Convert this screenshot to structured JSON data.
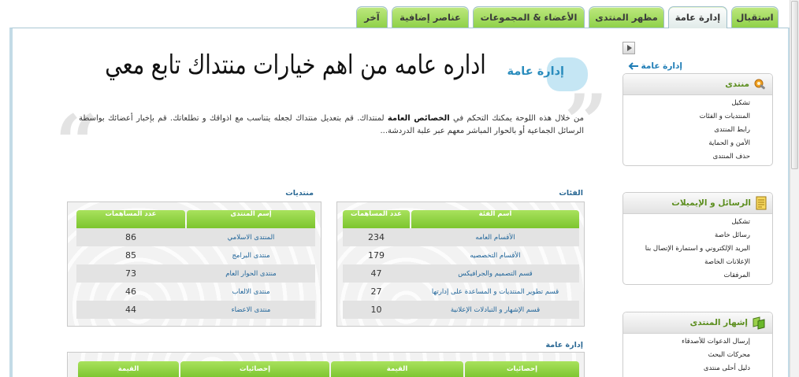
{
  "active_tab_index": 1,
  "colors": {
    "tab_green": "#8fd14a",
    "header_green": "#7cc52f",
    "link_blue": "#1f7db6",
    "section_title_green": "#5c8e1f",
    "title_bubble": "#c5e6f4"
  },
  "tabs": [
    {
      "label": "استقبال"
    },
    {
      "label": "إدارة عامة"
    },
    {
      "label": "مظهر المنتدى"
    },
    {
      "label": "الأعضاء & المجموعات"
    },
    {
      "label": "عناصر إضافية"
    },
    {
      "label": "آخر"
    }
  ],
  "sidebar": {
    "collapse_icon": "play-arrow-icon",
    "link": {
      "label": "إدارة عامة",
      "icon": "arrow-left-icon"
    },
    "sections": [
      {
        "title": "منتدى",
        "icon": "wrench-icon",
        "items": [
          "تشكيل",
          "المنتديات و الفئات",
          "رابط المنتدى",
          "الأمن و الحماية",
          "حذف المنتدى"
        ]
      },
      {
        "title": "الرسائل و الإيميلات",
        "icon": "document-icon",
        "items": [
          "تشكيل",
          "رسائل خاصة",
          "البريد الإلكتروني و استمارة الإتصال بنا",
          "الإعلانات الخاصة",
          "المرفقات"
        ]
      },
      {
        "title": "إشهار المنتدى",
        "icon": "flags-icon",
        "items": [
          "إرسال الدعوات للأصدقاء",
          "محركات البحث",
          "دليل أحلى منتدى"
        ]
      }
    ]
  },
  "main": {
    "title": "إدارة عامة",
    "annotation": "اداره عامه من اهم خيارات منتداك تابع معي",
    "quote_icons": [
      "quote-close-icon",
      "quote-open-icon"
    ],
    "description": {
      "before": "من خلال هذه اللوحة يمكنك التحكم في ",
      "bold": "الخصائص العامة",
      "after": " لمنتداك. قم بتعديل منتداك لجعله يتناسب مع اذواقك و تطلعاتك. قم بإخبار أعضائك بواسطة الرسائل الجماعية أو بالحوار المباشر معهم عبر علبة الدردشة..."
    },
    "categories_table": {
      "title": "الفئات",
      "headers": [
        "اسم الفئة",
        "عدد المساهمات"
      ],
      "rows": [
        {
          "name": "الأقسام العامه",
          "posts": 234
        },
        {
          "name": "الأقسام التخصصيه",
          "posts": 179
        },
        {
          "name": "قسم التصميم والجرافيكس",
          "posts": 47
        },
        {
          "name": "قسم تطوير المنتديات و المساعدة على إدارتها",
          "posts": 27
        },
        {
          "name": "قسم الإشهار و التبادلات الإعلانية",
          "posts": 10
        }
      ]
    },
    "forums_table": {
      "title": "منتديات",
      "headers": [
        "إسم المنتدى",
        "عدد المساهمات"
      ],
      "rows": [
        {
          "name": "المنتدى الاسلامي",
          "posts": 86
        },
        {
          "name": "منتدى البرامج",
          "posts": 85
        },
        {
          "name": "منتدى الحوار العام",
          "posts": 73
        },
        {
          "name": "منتدى الالعاب",
          "posts": 46
        },
        {
          "name": "منتدى الاعضاء",
          "posts": 44
        }
      ]
    },
    "stats_table": {
      "title": "إدارة عامة",
      "headers": [
        "إحصائيات",
        "القيمة",
        "إحصائيات",
        "القيمة"
      ]
    }
  }
}
